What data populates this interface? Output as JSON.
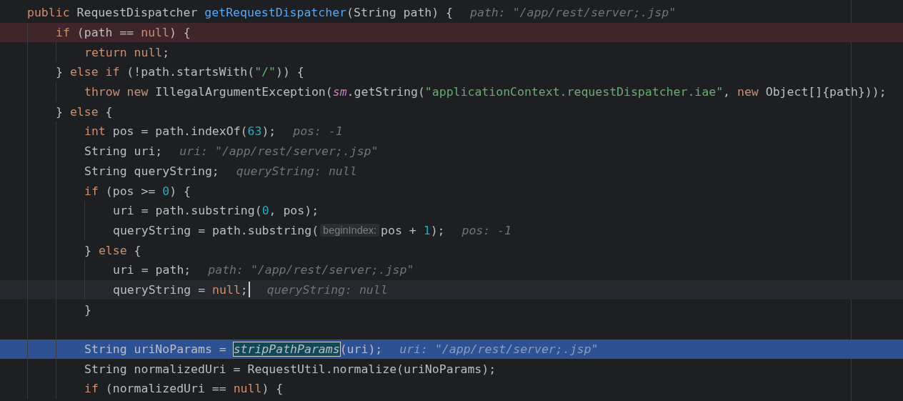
{
  "editor": {
    "lines": [
      {
        "tokens": [
          {
            "kind": "keyword",
            "text": "    public "
          },
          {
            "kind": "plain",
            "text": "RequestDispatcher "
          },
          {
            "kind": "declaration",
            "text": "getRequestDispatcher"
          },
          {
            "kind": "plain",
            "text": "(String path) {"
          }
        ],
        "hint": "path: \"/app/rest/server;.jsp\""
      },
      {
        "breakpoint": true,
        "current_line": false,
        "execution_point": false,
        "tokens": [
          {
            "kind": "keyword",
            "text": "        if "
          },
          {
            "kind": "plain",
            "text": "(path == "
          },
          {
            "kind": "keyword",
            "text": "null"
          },
          {
            "kind": "plain",
            "text": ") {"
          }
        ]
      },
      {
        "tokens": [
          {
            "kind": "keyword",
            "text": "            return null"
          },
          {
            "kind": "plain",
            "text": ";"
          }
        ]
      },
      {
        "tokens": [
          {
            "kind": "plain",
            "text": "        } "
          },
          {
            "kind": "keyword",
            "text": "else if "
          },
          {
            "kind": "plain",
            "text": "(!path.startsWith("
          },
          {
            "kind": "string",
            "text": "\"/\""
          },
          {
            "kind": "plain",
            "text": ")) {"
          }
        ]
      },
      {
        "tokens": [
          {
            "kind": "keyword",
            "text": "            throw new "
          },
          {
            "kind": "plain",
            "text": "IllegalArgumentException("
          },
          {
            "kind": "field",
            "text": "sm"
          },
          {
            "kind": "plain",
            "text": ".getString("
          },
          {
            "kind": "string",
            "text": "\"applicationContext.requestDispatcher.iae\""
          },
          {
            "kind": "plain",
            "text": ", "
          },
          {
            "kind": "keyword",
            "text": "new "
          },
          {
            "kind": "plain",
            "text": "Object[]{path}));"
          }
        ]
      },
      {
        "tokens": [
          {
            "kind": "plain",
            "text": "        } "
          },
          {
            "kind": "keyword",
            "text": "else "
          },
          {
            "kind": "plain",
            "text": "{"
          }
        ]
      },
      {
        "tokens": [
          {
            "kind": "keyword",
            "text": "            int "
          },
          {
            "kind": "plain",
            "text": "pos = path.indexOf("
          },
          {
            "kind": "number",
            "text": "63"
          },
          {
            "kind": "plain",
            "text": ");"
          }
        ],
        "hint": "pos: -1"
      },
      {
        "tokens": [
          {
            "kind": "plain",
            "text": "            String uri;"
          }
        ],
        "hint": "uri: \"/app/rest/server;.jsp\""
      },
      {
        "tokens": [
          {
            "kind": "plain",
            "text": "            String queryString;"
          }
        ],
        "hint": "queryString: null"
      },
      {
        "tokens": [
          {
            "kind": "keyword",
            "text": "            if "
          },
          {
            "kind": "plain",
            "text": "(pos >= "
          },
          {
            "kind": "number",
            "text": "0"
          },
          {
            "kind": "plain",
            "text": ") {"
          }
        ]
      },
      {
        "tokens": [
          {
            "kind": "plain",
            "text": "                uri = path.substring("
          },
          {
            "kind": "number",
            "text": "0"
          },
          {
            "kind": "plain",
            "text": ", pos);"
          }
        ]
      },
      {
        "tokens": [
          {
            "kind": "plain",
            "text": "                queryString = path.substring("
          },
          {
            "kind": "param_hint",
            "text": "beginIndex:"
          },
          {
            "kind": "plain",
            "text": "pos + "
          },
          {
            "kind": "number",
            "text": "1"
          },
          {
            "kind": "plain",
            "text": ");"
          }
        ],
        "hint": "pos: -1"
      },
      {
        "tokens": [
          {
            "kind": "plain",
            "text": "            } "
          },
          {
            "kind": "keyword",
            "text": "else "
          },
          {
            "kind": "plain",
            "text": "{"
          }
        ]
      },
      {
        "tokens": [
          {
            "kind": "plain",
            "text": "                uri = path;"
          }
        ],
        "hint": "path: \"/app/rest/server;.jsp\""
      },
      {
        "breakpoint": false,
        "current_line": true,
        "execution_point": false,
        "tokens": [
          {
            "kind": "plain",
            "text": "                queryString = "
          },
          {
            "kind": "keyword",
            "text": "null"
          },
          {
            "kind": "plain",
            "text": ";",
            "caret": true
          }
        ],
        "hint": "queryString: null"
      },
      {
        "tokens": [
          {
            "kind": "plain",
            "text": "            }"
          }
        ]
      },
      {
        "kind": "blank"
      },
      {
        "breakpoint": false,
        "current_line": false,
        "execution_point": true,
        "tokens": [
          {
            "kind": "plain",
            "text": "            String uriNoParams = "
          },
          {
            "kind": "static_call",
            "text": "stripPathParams",
            "match": true
          },
          {
            "kind": "plain",
            "text": "(uri);"
          }
        ],
        "hint": "uri: \"/app/rest/server;.jsp\""
      },
      {
        "tokens": [
          {
            "kind": "plain",
            "text": "            String normalizedUri = RequestUtil.normalize(uriNoParams);"
          }
        ]
      },
      {
        "tokens": [
          {
            "kind": "keyword",
            "text": "            if "
          },
          {
            "kind": "plain",
            "text": "(normalizedUri == "
          },
          {
            "kind": "keyword",
            "text": "null"
          },
          {
            "kind": "plain",
            "text": ") {"
          }
        ]
      }
    ]
  }
}
